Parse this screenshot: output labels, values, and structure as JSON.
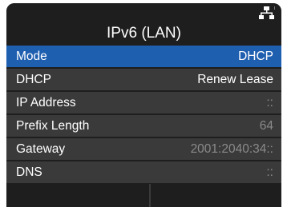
{
  "header": {
    "title": "IPv6 (LAN)",
    "status_icon": "network-icon"
  },
  "menu": {
    "items": [
      {
        "label": "Mode",
        "value": "DHCP",
        "selected": true
      },
      {
        "label": "DHCP",
        "value": "Renew Lease"
      },
      {
        "label": "IP Address",
        "value": "::"
      },
      {
        "label": "Prefix Length",
        "value": "64"
      },
      {
        "label": "Gateway",
        "value": "2001:2040:34::"
      },
      {
        "label": "DNS",
        "value": "::"
      }
    ]
  },
  "colors": {
    "background": "#1e1e1e",
    "row": "#3a3a3a",
    "selected": "#1f5fb0",
    "text": "#ffffff"
  }
}
